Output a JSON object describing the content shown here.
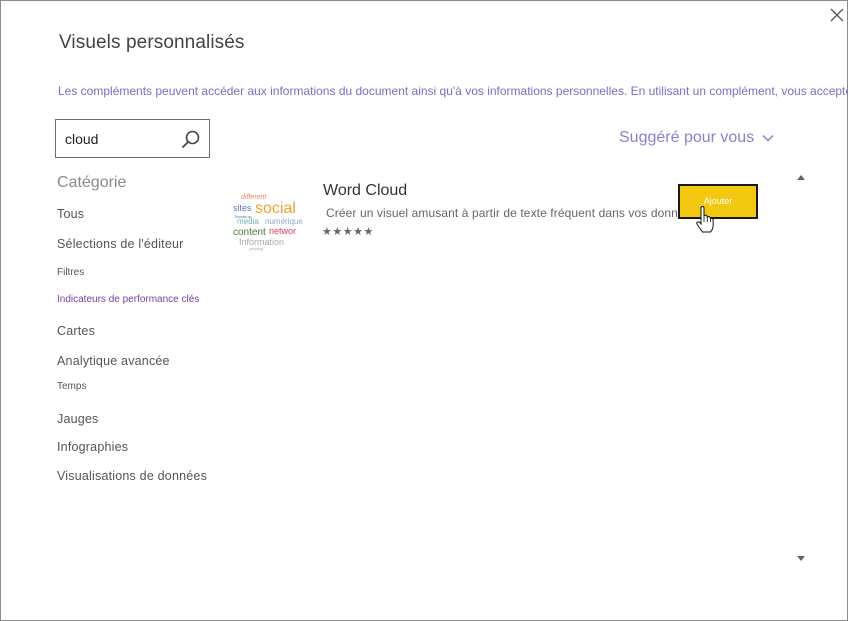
{
  "dialog": {
    "title": "Visuels personnalisés",
    "disclaimer": "Les compléments peuvent accéder aux informations du document ainsi qu'à vos informations personnelles. En utilisant un complément, vous acceptez"
  },
  "search": {
    "value": "cloud"
  },
  "sort": {
    "label": "Suggéré pour vous"
  },
  "sidebar": {
    "heading": "Catégorie",
    "items": [
      {
        "label": "Tous"
      },
      {
        "label": "Sélections de l'éditeur"
      },
      {
        "label": "Filtres"
      },
      {
        "label": "Indicateurs de performance clés"
      },
      {
        "label": "Cartes"
      },
      {
        "label": "Analytique avancée"
      },
      {
        "label": "Temps"
      },
      {
        "label": "Jauges"
      },
      {
        "label": "Infographies"
      },
      {
        "label": "Visualisations de données"
      }
    ]
  },
  "results": [
    {
      "title": "Word Cloud",
      "description": "Créer un visuel amusant à partir de texte fréquent dans vos données",
      "rating": "★★★★★",
      "add_label": "Ajouter",
      "thumbnail_words": [
        "different",
        "sites",
        "social",
        "Thumbs up",
        "media",
        "numérique",
        "content",
        "networ",
        "Information",
        "jumping"
      ]
    }
  ],
  "colors": {
    "accent": "#f2c811",
    "link": "#7a6fc1",
    "active_category": "#7b3f9e"
  }
}
